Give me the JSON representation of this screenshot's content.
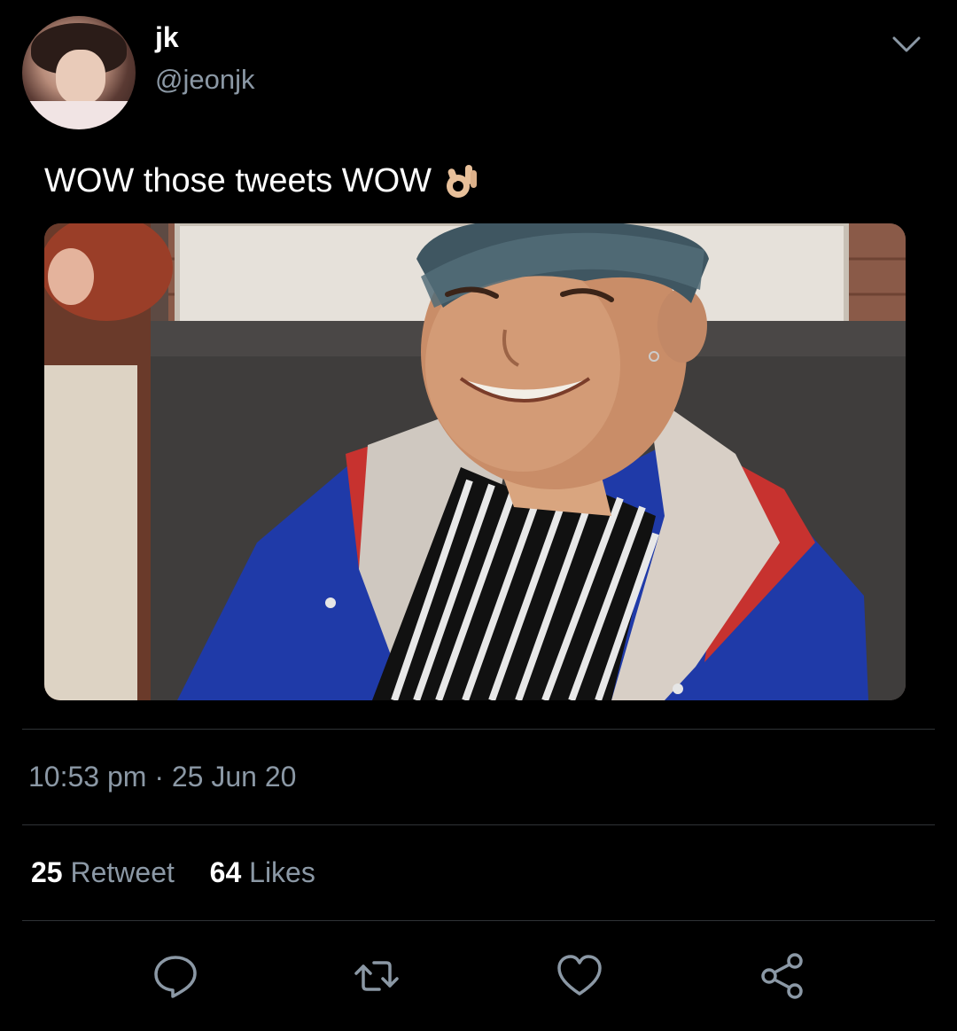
{
  "tweet": {
    "author": {
      "display_name": "jk",
      "handle": "@jeonjk"
    },
    "text": "WOW those tweets WOW",
    "emoji_icon": "ok-hand-emoji-icon",
    "timestamp": "10:53 pm · 25 Jun 20",
    "stats": {
      "retweets_count": "25",
      "retweets_label": "Retweet",
      "likes_count": "64",
      "likes_label": "Likes"
    },
    "actions": [
      {
        "name": "reply",
        "icon": "reply-icon"
      },
      {
        "name": "retweet",
        "icon": "retweet-icon"
      },
      {
        "name": "like",
        "icon": "heart-icon"
      },
      {
        "name": "share",
        "icon": "share-icon"
      }
    ]
  },
  "colors": {
    "background": "#000000",
    "primary_text": "#ffffff",
    "secondary_text": "#8b98a5",
    "divider": "#2f3336"
  }
}
